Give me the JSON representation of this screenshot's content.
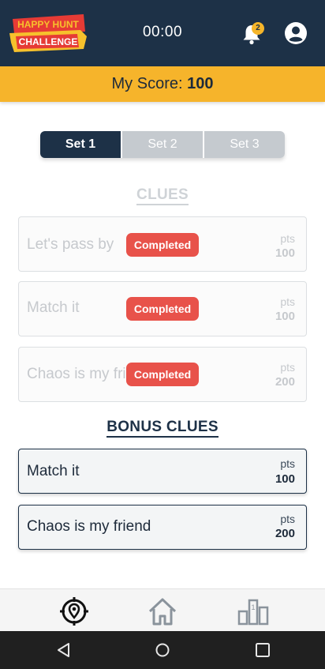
{
  "header": {
    "logo_line1": "HAPPY HUNT",
    "logo_line2": "CHALLENGE",
    "timer": "00:00",
    "notification_count": "2"
  },
  "score": {
    "label": "My Score:",
    "value": "100"
  },
  "tabs": [
    {
      "label": "Set 1",
      "active": true
    },
    {
      "label": "Set 2",
      "active": false
    },
    {
      "label": "Set 3",
      "active": false
    }
  ],
  "clues": {
    "title": "CLUES",
    "items": [
      {
        "name": "Let's pass by",
        "status": "Completed",
        "pts_label": "pts",
        "pts": "100"
      },
      {
        "name": "Match it",
        "status": "Completed",
        "pts_label": "pts",
        "pts": "100"
      },
      {
        "name": "Chaos is my friend",
        "status": "Completed",
        "pts_label": "pts",
        "pts": "200"
      }
    ]
  },
  "bonus": {
    "title": "BONUS CLUES",
    "items": [
      {
        "name": "Match it",
        "pts_label": "pts",
        "pts": "100"
      },
      {
        "name": "Chaos is my friend",
        "pts_label": "pts",
        "pts": "200"
      }
    ]
  },
  "bottom_nav": {
    "items": [
      "map-location-icon",
      "home-icon",
      "leaderboard-icon"
    ]
  },
  "system_nav": {
    "items": [
      "back-icon",
      "home-circle-icon",
      "recents-icon"
    ]
  },
  "colors": {
    "primary": "#1d3147",
    "accent": "#f6b42b",
    "completed": "#e8524a"
  }
}
